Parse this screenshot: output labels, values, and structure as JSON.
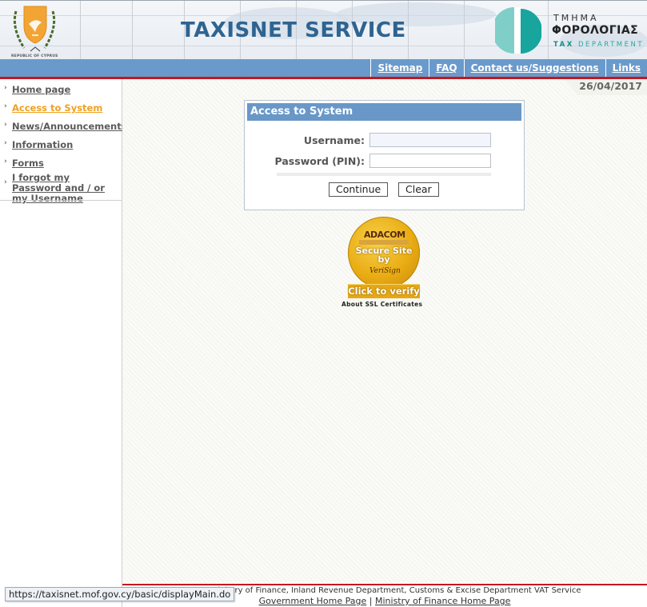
{
  "header": {
    "title": "TAXISNET SERVICE",
    "crest_caption": "REPUBLIC OF CYPRUS",
    "crest_icon": "cyprus-coat-of-arms",
    "dept_logo_icon": "tax-department-logo",
    "dept_line1": "ΤΜΗΜΑ",
    "dept_line2": "ΦΟΡΟΛΟΓΙΑΣ",
    "dept_line3_a": "TAX",
    "dept_line3_b": " DEPARTMENT"
  },
  "top_links": [
    {
      "label": "Sitemap"
    },
    {
      "label": "FAQ"
    },
    {
      "label": "Contact us/Suggestions"
    },
    {
      "label": "Links"
    }
  ],
  "date": "26/04/2017",
  "sidebar": {
    "items": [
      {
        "label": "Home page",
        "active": false
      },
      {
        "label": "Access to System",
        "active": true
      },
      {
        "label": "News/Announcements",
        "active": false
      },
      {
        "label": "Information",
        "active": false
      },
      {
        "label": "Forms",
        "active": false
      },
      {
        "label": "I forgot my Password and / or my Username",
        "active": false
      }
    ]
  },
  "login": {
    "title": "Access to System",
    "username_label": "Username:",
    "username_value": "",
    "password_label": "Password (PIN):",
    "password_value": "",
    "continue_label": "Continue",
    "clear_label": "Clear"
  },
  "ssl": {
    "brand": "ADACOM",
    "secure_line1": "Secure Site",
    "secure_line2": "by",
    "verisign": "VeriSign",
    "click_label": "Click to verify",
    "about_label": "About SSL Certificates"
  },
  "footer": {
    "text": "prus, Ministry of Finance, Inland Revenue Department, Customs & Excise Department VAT Service",
    "link1": "Government Home Page",
    "separator": "|",
    "link2": "Ministry of Finance Home Page"
  },
  "status_bar": {
    "url": "https://taxisnet.mof.gov.cy/basic/displayMain.do"
  },
  "colors": {
    "nav_blue": "#6a9acb",
    "accent_red": "#c4171f",
    "active_link": "#f0a020",
    "title_blue": "#2e6491",
    "teal": "#2aa9a4"
  }
}
